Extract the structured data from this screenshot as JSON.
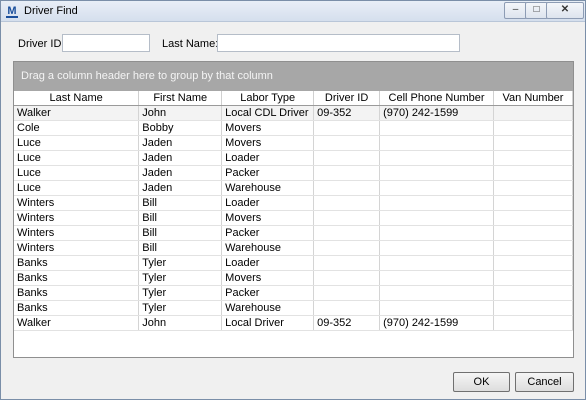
{
  "window": {
    "title": "Driver Find",
    "app_icon_letter": "M"
  },
  "controls": {
    "minimize": "–",
    "maximize": "□",
    "close": "✕"
  },
  "filters": {
    "driver_id_label": "Driver ID:",
    "driver_id_value": "",
    "last_name_label": "Last Name:",
    "last_name_value": ""
  },
  "grid": {
    "group_hint": "Drag a column header here to group by that column",
    "columns": [
      "Last Name",
      "First Name",
      "Labor Type",
      "Driver ID",
      "Cell Phone Number",
      "Van Number"
    ],
    "rows": [
      [
        "Walker",
        "John",
        "Local CDL Driver",
        "09-352",
        "(970) 242-1599",
        ""
      ],
      [
        "Cole",
        "Bobby",
        "Movers",
        "",
        "",
        ""
      ],
      [
        "Luce",
        "Jaden",
        "Movers",
        "",
        "",
        ""
      ],
      [
        "Luce",
        "Jaden",
        "Loader",
        "",
        "",
        ""
      ],
      [
        "Luce",
        "Jaden",
        "Packer",
        "",
        "",
        ""
      ],
      [
        "Luce",
        "Jaden",
        "Warehouse",
        "",
        "",
        ""
      ],
      [
        "Winters",
        "Bill",
        "Loader",
        "",
        "",
        ""
      ],
      [
        "Winters",
        "Bill",
        "Movers",
        "",
        "",
        ""
      ],
      [
        "Winters",
        "Bill",
        "Packer",
        "",
        "",
        ""
      ],
      [
        "Winters",
        "Bill",
        "Warehouse",
        "",
        "",
        ""
      ],
      [
        "Banks",
        "Tyler",
        "Loader",
        "",
        "",
        ""
      ],
      [
        "Banks",
        "Tyler",
        "Movers",
        "",
        "",
        ""
      ],
      [
        "Banks",
        "Tyler",
        "Packer",
        "",
        "",
        ""
      ],
      [
        "Banks",
        "Tyler",
        "Warehouse",
        "",
        "",
        ""
      ],
      [
        "Walker",
        "John",
        "Local Driver",
        "09-352",
        "(970) 242-1599",
        ""
      ]
    ]
  },
  "buttons": {
    "ok": "OK",
    "cancel": "Cancel"
  }
}
